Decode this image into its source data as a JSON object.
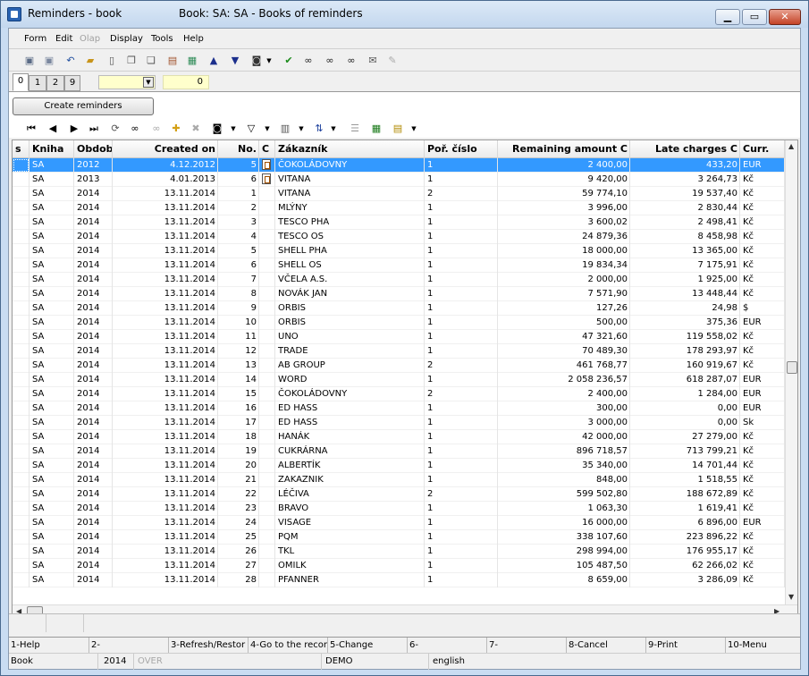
{
  "window": {
    "title": "Reminders - book",
    "book_title": "Book: SA: SA - Books of reminders",
    "min_glyph": "▁",
    "max_glyph": "▭",
    "close_glyph": "✕"
  },
  "menu": [
    {
      "label": "Form",
      "enabled": true
    },
    {
      "label": "Edit",
      "enabled": true
    },
    {
      "label": "Olap",
      "enabled": false
    },
    {
      "label": "Display",
      "enabled": true
    },
    {
      "label": "Tools",
      "enabled": true
    },
    {
      "label": "Help",
      "enabled": true
    }
  ],
  "tabs": [
    "0",
    "1",
    "2",
    "9"
  ],
  "tab_count": "0",
  "create_button": "Create reminders",
  "columns": [
    "s",
    "Kniha",
    "Obdob",
    "Created on",
    "No.",
    "C",
    "Zákazník",
    "Poř. číslo",
    "Remaining amount C",
    "Late charges C",
    "Curr."
  ],
  "rows": [
    {
      "kniha": "SA",
      "obdobi": "2012",
      "created": "4.12.2012",
      "no": "5",
      "doc": true,
      "zakaznik": "ČOKOLÁDOVNY",
      "por": "1",
      "remaining": "2 400,00",
      "late": "433,20",
      "curr": "EUR",
      "selected": true
    },
    {
      "kniha": "SA",
      "obdobi": "2013",
      "created": "4.01.2013",
      "no": "6",
      "doc": true,
      "zakaznik": "VITANA",
      "por": "1",
      "remaining": "9 420,00",
      "late": "3 264,73",
      "curr": "Kč"
    },
    {
      "kniha": "SA",
      "obdobi": "2014",
      "created": "13.11.2014",
      "no": "1",
      "zakaznik": "VITANA",
      "por": "2",
      "remaining": "59 774,10",
      "late": "19 537,40",
      "curr": "Kč"
    },
    {
      "kniha": "SA",
      "obdobi": "2014",
      "created": "13.11.2014",
      "no": "2",
      "zakaznik": "MLÝNY",
      "por": "1",
      "remaining": "3 996,00",
      "late": "2 830,44",
      "curr": "Kč"
    },
    {
      "kniha": "SA",
      "obdobi": "2014",
      "created": "13.11.2014",
      "no": "3",
      "zakaznik": "TESCO PHA",
      "por": "1",
      "remaining": "3 600,02",
      "late": "2 498,41",
      "curr": "Kč"
    },
    {
      "kniha": "SA",
      "obdobi": "2014",
      "created": "13.11.2014",
      "no": "4",
      "zakaznik": "TESCO OS",
      "por": "1",
      "remaining": "24 879,36",
      "late": "8 458,98",
      "curr": "Kč"
    },
    {
      "kniha": "SA",
      "obdobi": "2014",
      "created": "13.11.2014",
      "no": "5",
      "zakaznik": "SHELL PHA",
      "por": "1",
      "remaining": "18 000,00",
      "late": "13 365,00",
      "curr": "Kč"
    },
    {
      "kniha": "SA",
      "obdobi": "2014",
      "created": "13.11.2014",
      "no": "6",
      "zakaznik": "SHELL OS",
      "por": "1",
      "remaining": "19 834,34",
      "late": "7 175,91",
      "curr": "Kč"
    },
    {
      "kniha": "SA",
      "obdobi": "2014",
      "created": "13.11.2014",
      "no": "7",
      "zakaznik": "VČELA A.S.",
      "por": "1",
      "remaining": "2 000,00",
      "late": "1 925,00",
      "curr": "Kč"
    },
    {
      "kniha": "SA",
      "obdobi": "2014",
      "created": "13.11.2014",
      "no": "8",
      "zakaznik": "NOVÁK JAN",
      "por": "1",
      "remaining": "7 571,90",
      "late": "13 448,44",
      "curr": "Kč"
    },
    {
      "kniha": "SA",
      "obdobi": "2014",
      "created": "13.11.2014",
      "no": "9",
      "zakaznik": "ORBIS",
      "por": "1",
      "remaining": "127,26",
      "late": "24,98",
      "curr": "$"
    },
    {
      "kniha": "SA",
      "obdobi": "2014",
      "created": "13.11.2014",
      "no": "10",
      "zakaznik": "ORBIS",
      "por": "1",
      "remaining": "500,00",
      "late": "375,36",
      "curr": "EUR"
    },
    {
      "kniha": "SA",
      "obdobi": "2014",
      "created": "13.11.2014",
      "no": "11",
      "zakaznik": "UNO",
      "por": "1",
      "remaining": "47 321,60",
      "late": "119 558,02",
      "curr": "Kč"
    },
    {
      "kniha": "SA",
      "obdobi": "2014",
      "created": "13.11.2014",
      "no": "12",
      "zakaznik": "TRADE",
      "por": "1",
      "remaining": "70 489,30",
      "late": "178 293,97",
      "curr": "Kč"
    },
    {
      "kniha": "SA",
      "obdobi": "2014",
      "created": "13.11.2014",
      "no": "13",
      "zakaznik": "AB GROUP",
      "por": "2",
      "remaining": "461 768,77",
      "late": "160 919,67",
      "curr": "Kč"
    },
    {
      "kniha": "SA",
      "obdobi": "2014",
      "created": "13.11.2014",
      "no": "14",
      "zakaznik": "WORD",
      "por": "1",
      "remaining": "2 058 236,57",
      "late": "618 287,07",
      "curr": "EUR"
    },
    {
      "kniha": "SA",
      "obdobi": "2014",
      "created": "13.11.2014",
      "no": "15",
      "zakaznik": "ČOKOLÁDOVNY",
      "por": "2",
      "remaining": "2 400,00",
      "late": "1 284,00",
      "curr": "EUR"
    },
    {
      "kniha": "SA",
      "obdobi": "2014",
      "created": "13.11.2014",
      "no": "16",
      "zakaznik": "ED HASS",
      "por": "1",
      "remaining": "300,00",
      "late": "0,00",
      "curr": "EUR"
    },
    {
      "kniha": "SA",
      "obdobi": "2014",
      "created": "13.11.2014",
      "no": "17",
      "zakaznik": "ED HASS",
      "por": "1",
      "remaining": "3 000,00",
      "late": "0,00",
      "curr": "Sk"
    },
    {
      "kniha": "SA",
      "obdobi": "2014",
      "created": "13.11.2014",
      "no": "18",
      "zakaznik": "HANÁK",
      "por": "1",
      "remaining": "42 000,00",
      "late": "27 279,00",
      "curr": "Kč"
    },
    {
      "kniha": "SA",
      "obdobi": "2014",
      "created": "13.11.2014",
      "no": "19",
      "zakaznik": "CUKRÁRNA",
      "por": "1",
      "remaining": "896 718,57",
      "late": "713 799,21",
      "curr": "Kč"
    },
    {
      "kniha": "SA",
      "obdobi": "2014",
      "created": "13.11.2014",
      "no": "20",
      "zakaznik": "ALBERTÍK",
      "por": "1",
      "remaining": "35 340,00",
      "late": "14 701,44",
      "curr": "Kč"
    },
    {
      "kniha": "SA",
      "obdobi": "2014",
      "created": "13.11.2014",
      "no": "21",
      "zakaznik": "ZAKAZNIK",
      "por": "1",
      "remaining": "848,00",
      "late": "1 518,55",
      "curr": "Kč"
    },
    {
      "kniha": "SA",
      "obdobi": "2014",
      "created": "13.11.2014",
      "no": "22",
      "zakaznik": "LÉČIVA",
      "por": "2",
      "remaining": "599 502,80",
      "late": "188 672,89",
      "curr": "Kč"
    },
    {
      "kniha": "SA",
      "obdobi": "2014",
      "created": "13.11.2014",
      "no": "23",
      "zakaznik": "BRAVO",
      "por": "1",
      "remaining": "1 063,30",
      "late": "1 619,41",
      "curr": "Kč"
    },
    {
      "kniha": "SA",
      "obdobi": "2014",
      "created": "13.11.2014",
      "no": "24",
      "zakaznik": "VISAGE",
      "por": "1",
      "remaining": "16 000,00",
      "late": "6 896,00",
      "curr": "EUR"
    },
    {
      "kniha": "SA",
      "obdobi": "2014",
      "created": "13.11.2014",
      "no": "25",
      "zakaznik": "PQM",
      "por": "1",
      "remaining": "338 107,60",
      "late": "223 896,22",
      "curr": "Kč"
    },
    {
      "kniha": "SA",
      "obdobi": "2014",
      "created": "13.11.2014",
      "no": "26",
      "zakaznik": "TKL",
      "por": "1",
      "remaining": "298 994,00",
      "late": "176 955,17",
      "curr": "Kč"
    },
    {
      "kniha": "SA",
      "obdobi": "2014",
      "created": "13.11.2014",
      "no": "27",
      "zakaznik": "OMILK",
      "por": "1",
      "remaining": "105 487,50",
      "late": "62 266,02",
      "curr": "Kč"
    },
    {
      "kniha": "SA",
      "obdobi": "2014",
      "created": "13.11.2014",
      "no": "28",
      "zakaznik": "PFANNER",
      "por": "1",
      "remaining": "8 659,00",
      "late": "3 286,09",
      "curr": "Kč"
    }
  ],
  "fkeys": [
    "1-Help",
    "2-",
    "3-Refresh/Restor",
    "4-Go to the recor",
    "5-Change",
    "6-",
    "7-",
    "8-Cancel",
    "9-Print",
    "10-Menu"
  ],
  "status": {
    "book": "Book",
    "year": "2014",
    "over": "OVER",
    "company": "DEMO",
    "language": "english"
  },
  "toolbar_icons": [
    "save-icon",
    "save-as-icon",
    "undo-icon",
    "open-folder-icon",
    "new-doc-icon",
    "copy-icon",
    "paste-icon",
    "book-icon",
    "books-icon",
    "arrow-up-icon",
    "arrow-down-icon",
    "camera-dropdown-icon",
    "filter-check-icon",
    "binoculars-icon",
    "find-next-icon",
    "find-replace-icon",
    "mail-icon",
    "edit-icon"
  ],
  "nav_icons": [
    "first-icon",
    "prev-icon",
    "next-icon",
    "last-icon",
    "refresh-icon",
    "binoculars-icon",
    "binoculars-disabled-icon",
    "add-icon",
    "remove-icon",
    "camera-icon",
    "filter-icon",
    "columns-icon",
    "sort-icon",
    "tree-icon",
    "excel-icon",
    "calculator-icon"
  ]
}
